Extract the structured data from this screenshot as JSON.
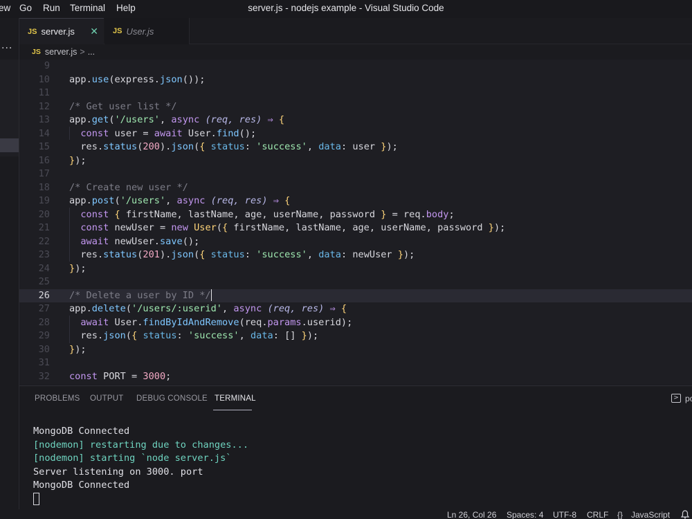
{
  "window": {
    "title": "server.js - nodejs example - Visual Studio Code",
    "menu": [
      "ew",
      "Go",
      "Run",
      "Terminal",
      "Help"
    ],
    "side_overflow": "···"
  },
  "tabs": [
    {
      "badge": "JS",
      "label": "server.js",
      "active": true,
      "close": "✕"
    },
    {
      "badge": "JS",
      "label": "User.js",
      "active": false
    }
  ],
  "breadcrumb": {
    "badge": "JS",
    "file": "server.js",
    "separator": ">",
    "tail": "..."
  },
  "editor": {
    "current_line": 26,
    "lines": [
      {
        "n": "9"
      },
      {
        "n": "10"
      },
      {
        "n": "11"
      },
      {
        "n": "12"
      },
      {
        "n": "13"
      },
      {
        "n": "14"
      },
      {
        "n": "15"
      },
      {
        "n": "16"
      },
      {
        "n": "17"
      },
      {
        "n": "18"
      },
      {
        "n": "19"
      },
      {
        "n": "20"
      },
      {
        "n": "21"
      },
      {
        "n": "22"
      },
      {
        "n": "23"
      },
      {
        "n": "24"
      },
      {
        "n": "25"
      },
      {
        "n": "26"
      },
      {
        "n": "27"
      },
      {
        "n": "28"
      },
      {
        "n": "29"
      },
      {
        "n": "30"
      },
      {
        "n": "31"
      },
      {
        "n": "32"
      }
    ],
    "tokens": {
      "app": "app",
      "use": "use",
      "express": "express",
      "json": "json",
      "get": "get",
      "post": "post",
      "delete": "delete",
      "status": "status",
      "async": "async",
      "req": "req",
      "res": "res",
      "arrow": "⇒",
      "const": "const",
      "await": "await",
      "new": "new",
      "user": "user",
      "User": "User",
      "find": "find",
      "str_users": "'/users'",
      "str_users_id": "'/users/:userid'",
      "str_success": "'success'",
      "cmt_get": "/* Get user list */",
      "cmt_create": "/* Create new user */",
      "cmt_delete": "/* Delete a user by ID */",
      "n200": "200",
      "n201": "201",
      "n3000": "3000",
      "firstName": "firstName",
      "lastName": "lastName",
      "age": "age",
      "userName": "userName",
      "password": "password",
      "req_prop": "req",
      "body": "body",
      "params": "params",
      "userid": "userid",
      "newUser": "newUser",
      "save": "save",
      "findByIdAndRemove": "findByIdAndRemove",
      "status_key": "status",
      "data_key": "data",
      "PORT": "PORT"
    }
  },
  "panel": {
    "tabs": [
      "PROBLEMS",
      "OUTPUT",
      "DEBUG CONSOLE",
      "TERMINAL"
    ],
    "active_tab": "TERMINAL",
    "terminal_icon": ">",
    "terminal_name": "pc",
    "output": [
      {
        "text": "MongoDB Connected",
        "style": "normal"
      },
      {
        "text": "[nodemon] restarting due to changes...",
        "style": "nodemon"
      },
      {
        "text": "[nodemon] starting `node server.js`",
        "style": "nodemon"
      },
      {
        "text": "Server listening on 3000. port",
        "style": "normal"
      },
      {
        "text": "MongoDB Connected",
        "style": "normal"
      }
    ]
  },
  "statusbar": {
    "position": "Ln 26, Col 26",
    "spaces": "Spaces: 4",
    "encoding": "UTF-8",
    "eol": "CRLF",
    "language_icon": "{}",
    "language": "JavaScript",
    "bell_icon": "bell-icon"
  }
}
